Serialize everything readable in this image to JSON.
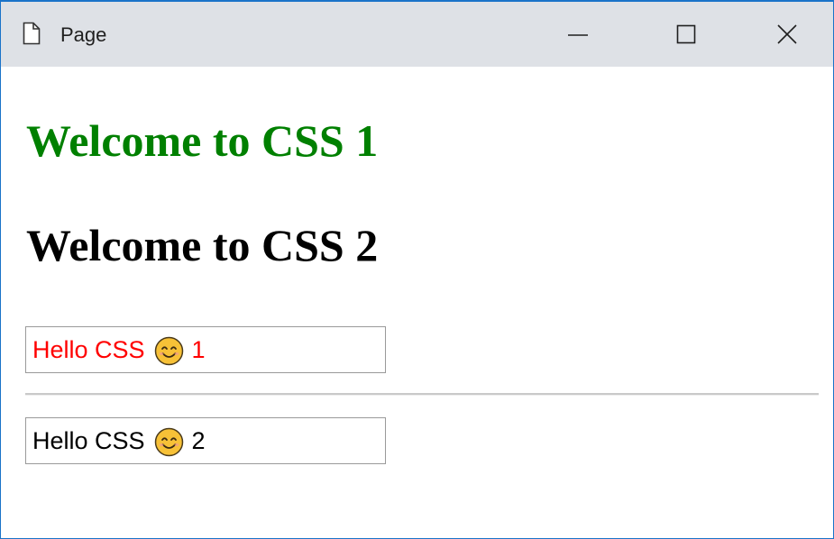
{
  "window": {
    "title": "Page"
  },
  "content": {
    "heading1": "Welcome to CSS 1",
    "heading2": "Welcome to CSS 2",
    "box1": {
      "text_before": "Hello CSS",
      "text_after": "1"
    },
    "box2": {
      "text_before": "Hello CSS",
      "text_after": "2"
    }
  },
  "colors": {
    "heading1": "#008000",
    "heading2": "#000000",
    "box1_text": "#ff0000",
    "box2_text": "#000000",
    "titlebar": "#dee1e6",
    "window_border": "#1a73c9"
  },
  "icons": {
    "title": "page-icon",
    "minimize": "minimize-icon",
    "maximize": "maximize-icon",
    "close": "close-icon",
    "emoji": "smiling-face-icon"
  }
}
